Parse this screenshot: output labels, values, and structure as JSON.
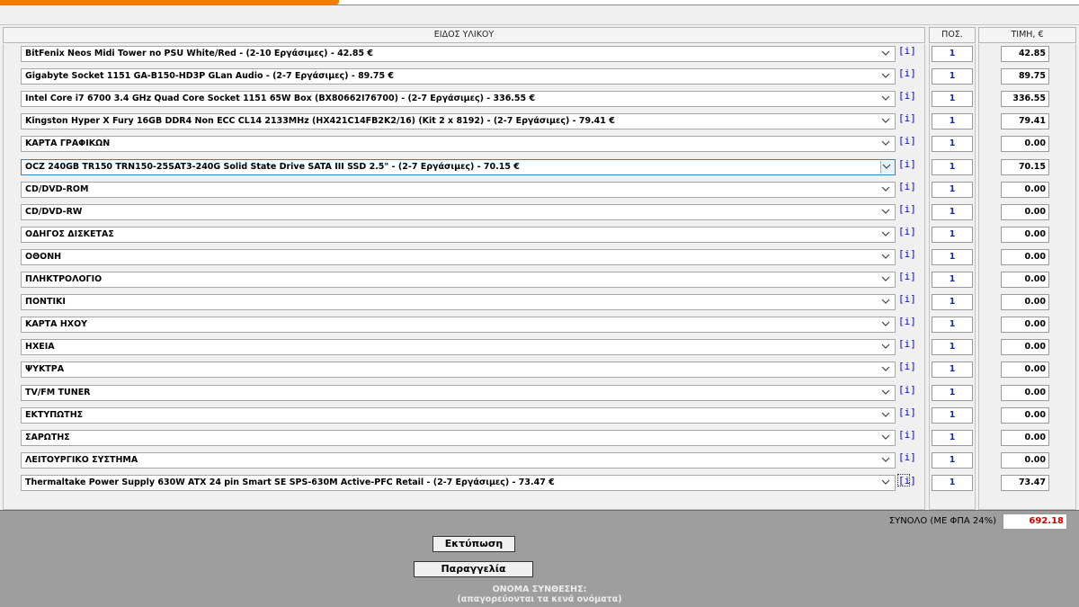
{
  "header": {
    "item_col": "ΕΙΔΟΣ ΥΛΙΚΟΥ",
    "qty_col": "ΠΟΣ.",
    "price_col": "ΤΙΜΗ, €"
  },
  "info_label": "[i]",
  "rows": [
    {
      "item": "BitFenix Neos Midi Tower no PSU White/Red - (2-10 Εργάσιμες) - 42.85 €",
      "qty": "1",
      "price": "42.85"
    },
    {
      "item": "Gigabyte Socket 1151 GA-B150-HD3P GLan Audio - (2-7 Εργάσιμες) - 89.75 €",
      "qty": "1",
      "price": "89.75"
    },
    {
      "item": "Intel Core i7 6700 3.4 GHz Quad Core Socket 1151 65W Box (BX80662I76700) - (2-7 Εργάσιμες) - 336.55 €",
      "qty": "1",
      "price": "336.55"
    },
    {
      "item": "Kingston Hyper X Fury 16GB DDR4 Non ECC CL14 2133MHz (HX421C14FB2K2/16) (Kit 2 x 8192) - (2-7 Εργάσιμες) - 79.41 €",
      "qty": "1",
      "price": "79.41"
    },
    {
      "item": "ΚΑΡΤΑ ΓΡΑΦΙΚΩΝ",
      "qty": "1",
      "price": "0.00"
    },
    {
      "item": "OCZ 240GB TR150 TRN150-25SAT3-240G Solid State Drive SATA III SSD 2.5\" - (2-7 Εργάσιμες) - 70.15 €",
      "qty": "1",
      "price": "70.15"
    },
    {
      "item": "CD/DVD-ROM",
      "qty": "1",
      "price": "0.00"
    },
    {
      "item": "CD/DVD-RW",
      "qty": "1",
      "price": "0.00"
    },
    {
      "item": "ΟΔΗΓΟΣ ΔΙΣΚΕΤΑΣ",
      "qty": "1",
      "price": "0.00"
    },
    {
      "item": "ΟΘΟΝΗ",
      "qty": "1",
      "price": "0.00"
    },
    {
      "item": "ΠΛΗΚΤΡΟΛΟΓΙΟ",
      "qty": "1",
      "price": "0.00"
    },
    {
      "item": "ΠΟΝΤΙΚΙ",
      "qty": "1",
      "price": "0.00"
    },
    {
      "item": "ΚΑΡΤΑ ΗΧΟΥ",
      "qty": "1",
      "price": "0.00"
    },
    {
      "item": "ΗΧΕΙΑ",
      "qty": "1",
      "price": "0.00"
    },
    {
      "item": "ΨΥΚΤΡΑ",
      "qty": "1",
      "price": "0.00"
    },
    {
      "item": "TV/FM TUNER",
      "qty": "1",
      "price": "0.00"
    },
    {
      "item": "ΕΚΤΥΠΩΤΗΣ",
      "qty": "1",
      "price": "0.00"
    },
    {
      "item": "ΣΑΡΩΤΗΣ",
      "qty": "1",
      "price": "0.00"
    },
    {
      "item": "ΛΕΙΤΟΥΡΓΙΚΟ ΣΥΣΤΗΜΑ",
      "qty": "1",
      "price": "0.00"
    },
    {
      "item": "Thermaltake Power Supply 630W ATX 24 pin Smart SE SPS-630M Active-PFC Retail - (2-7 Εργάσιμες) - 73.47 €",
      "qty": "1",
      "price": "73.47"
    }
  ],
  "total": {
    "label": "ΣΥΝΟΛΟ (ΜΕ ΦΠΑ 24%)",
    "value": "692.18"
  },
  "buttons": {
    "print": "Εκτύπωση",
    "order": "Παραγγελία"
  },
  "name_section": {
    "label": "ΟΝΟΜΑ ΣΥΝΘΕΣΗΣ:",
    "hint": "(απαγορεύονται τα κενά ονόματα)"
  },
  "colors": {
    "accent_tab": "#f07c00",
    "qty_text": "#0d2bbd",
    "total_text": "#d40000",
    "info_link": "#0000ee"
  }
}
